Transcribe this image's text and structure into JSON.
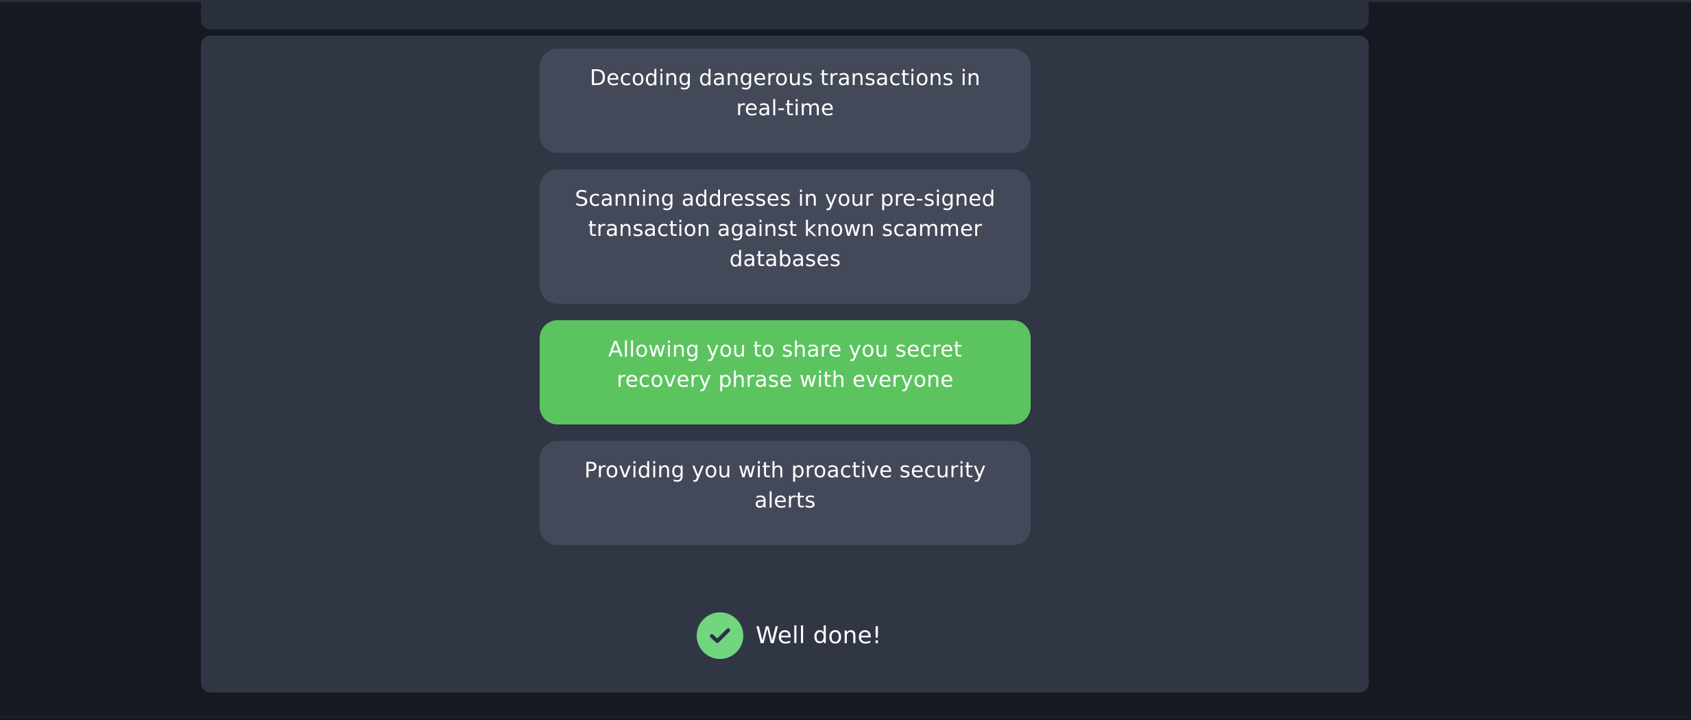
{
  "quiz": {
    "options": [
      {
        "label": "Decoding dangerous transactions in real-time",
        "state": "default"
      },
      {
        "label": "Scanning addresses in your pre-signed transaction against known scammer databases",
        "state": "default"
      },
      {
        "label": "Allowing you to share you secret recovery phrase with everyone",
        "state": "selected-correct"
      },
      {
        "label": "Providing you with proactive security alerts",
        "state": "default"
      }
    ],
    "feedback": {
      "icon": "checkmark-icon",
      "text": "Well done!"
    }
  },
  "colors": {
    "page_bg": "#151922",
    "panel_bg": "#313644",
    "option_bg": "#434958",
    "option_selected_bg": "#5cc45f",
    "check_circle_bg": "#72d57f",
    "check_mark": "#2b3140"
  }
}
